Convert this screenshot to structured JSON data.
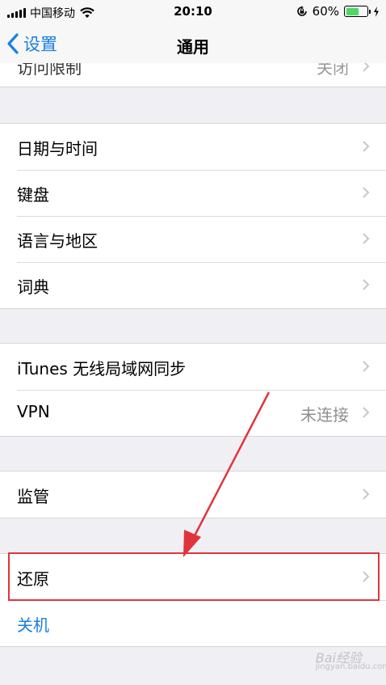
{
  "status_bar": {
    "carrier": "中国移动",
    "time": "20:10",
    "battery_percent": "60%",
    "battery_level": 0.6
  },
  "nav": {
    "back_label": "设置",
    "title": "通用"
  },
  "partial_row": {
    "label": "访问限制",
    "value": "关闭"
  },
  "groups": [
    {
      "rows": [
        {
          "label": "日期与时间"
        },
        {
          "label": "键盘"
        },
        {
          "label": "语言与地区"
        },
        {
          "label": "词典"
        }
      ]
    },
    {
      "rows": [
        {
          "label": "iTunes 无线局域网同步"
        },
        {
          "label": "VPN",
          "value": "未连接"
        }
      ]
    },
    {
      "rows": [
        {
          "label": "监管"
        }
      ]
    },
    {
      "rows": [
        {
          "label": "还原"
        },
        {
          "label": "关机"
        }
      ]
    }
  ],
  "watermark": {
    "text": "Bai经验",
    "sub": "jingyan.baidu.com"
  },
  "colors": {
    "accent": "#1a7ee0",
    "highlight": "#e0343c",
    "battery": "#4cd964"
  }
}
